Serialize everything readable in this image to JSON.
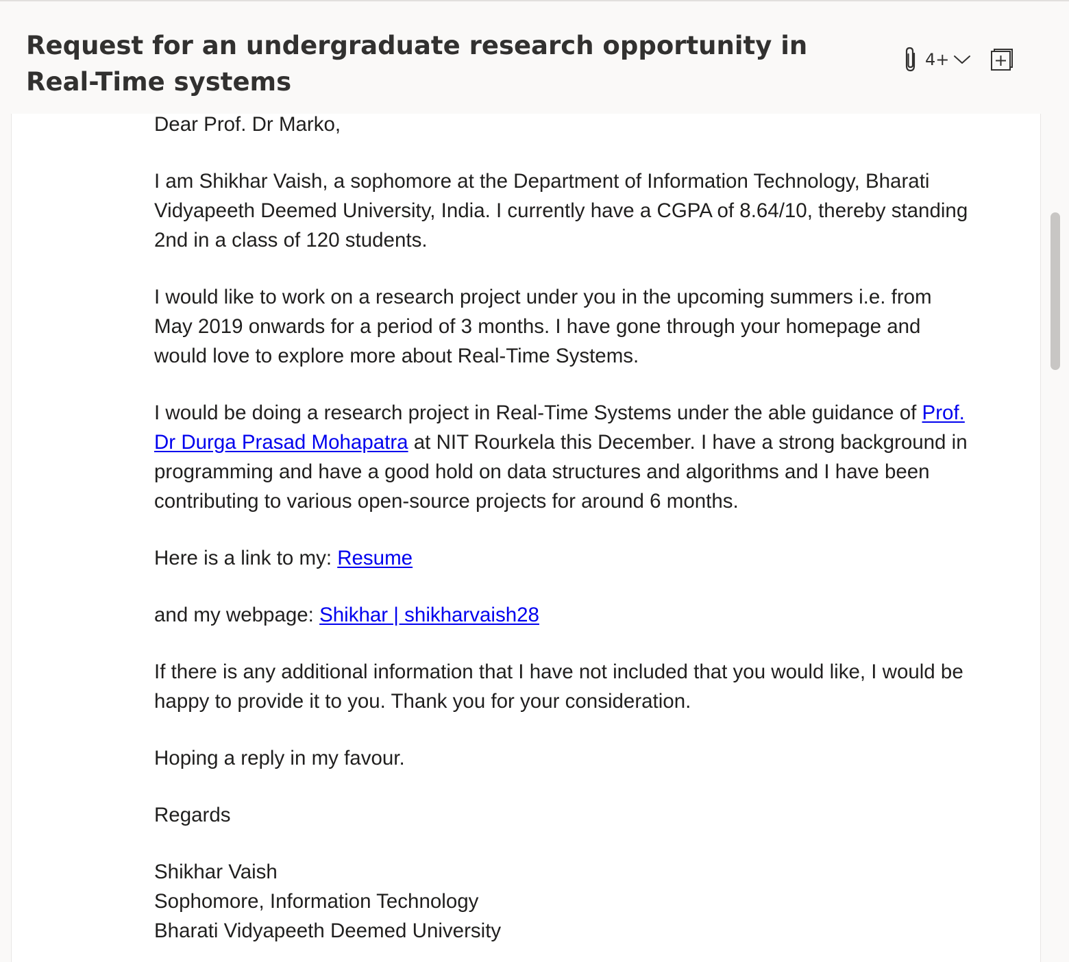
{
  "email": {
    "subject": "Request for an undergraduate research opportunity in Real-Time systems",
    "attachment_count": "4+",
    "icons": {
      "attachment": "paperclip-icon",
      "expand": "chevron-down-icon",
      "popout": "open-in-new-window-icon"
    },
    "body": {
      "greeting": "Dear Prof. Dr Marko,",
      "para1": "I am Shikhar Vaish, a sophomore at the Department of Information Technology, Bharati Vidyapeeth Deemed University, India. I currently have a CGPA of 8.64/10, thereby standing 2nd in a class of 120 students.",
      "para2": "I would like to work on a research project under you in the upcoming summers i.e. from May 2019 onwards for a period of 3 months. I have gone through your homepage and would love to explore more about Real-Time Systems.",
      "para3_before": "I would be doing a research project in Real-Time Systems under the able guidance of ",
      "para3_link": "Prof. Dr Durga Prasad Mohapatra",
      "para3_after": " at NIT Rourkela this December. I have a strong background in programming and have a good hold on data structures and algorithms and I have been contributing to various open-source projects for around 6 months.",
      "resume_prefix": "Here is a link to my: ",
      "resume_link": "Resume",
      "webpage_prefix": "and my webpage: ",
      "webpage_link": "Shikhar | shikharvaish28",
      "para4": "If there is any additional information that I have not included that you would like, I would be happy to provide it to you. Thank you for your consideration.",
      "closing_hope": "Hoping a reply in my favour.",
      "regards": "Regards",
      "signature": {
        "name": "Shikhar Vaish",
        "title": "Sophomore, Information Technology",
        "university": "Bharati Vidyapeeth Deemed University"
      }
    }
  },
  "colors": {
    "link": "#0000ee",
    "text": "#201f1e",
    "header_bg": "#faf9f8",
    "scrollbar": "#c8c6c4"
  }
}
